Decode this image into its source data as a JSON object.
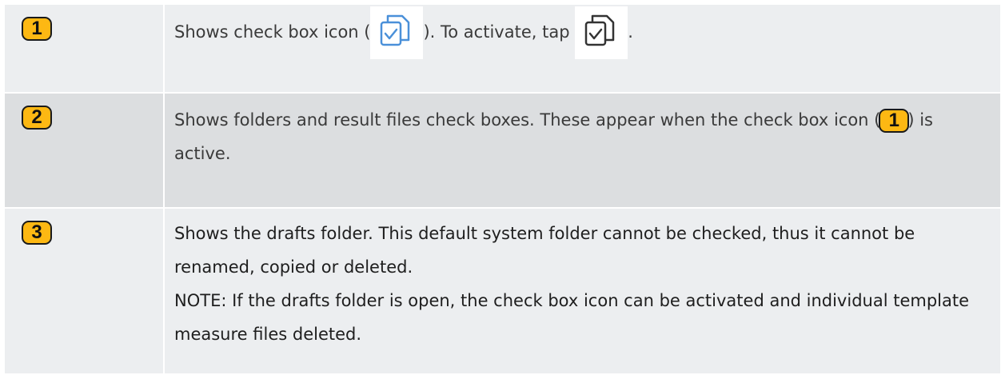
{
  "rows": [
    {
      "badge": "1",
      "text_a": "Shows check box icon (",
      "text_b": "). To activate, tap",
      "text_c": ".",
      "icon_inactive": "copy-check-icon-blue",
      "icon_active": "copy-check-icon-dark"
    },
    {
      "badge": "2",
      "text_a": "Shows folders and result files check boxes. These appear when the check box icon (",
      "inline_badge": "1",
      "text_b": ") is active."
    },
    {
      "badge": "3",
      "line1": "Shows the drafts folder. This default system folder cannot be checked, thus it cannot be renamed, copied or deleted.",
      "line2": "NOTE: If the drafts folder is open, the check box icon can be activated and individual template measure files deleted."
    }
  ],
  "colors": {
    "badge": "#fdb813",
    "icon_blue": "#4a90d9",
    "icon_dark": "#333333"
  }
}
